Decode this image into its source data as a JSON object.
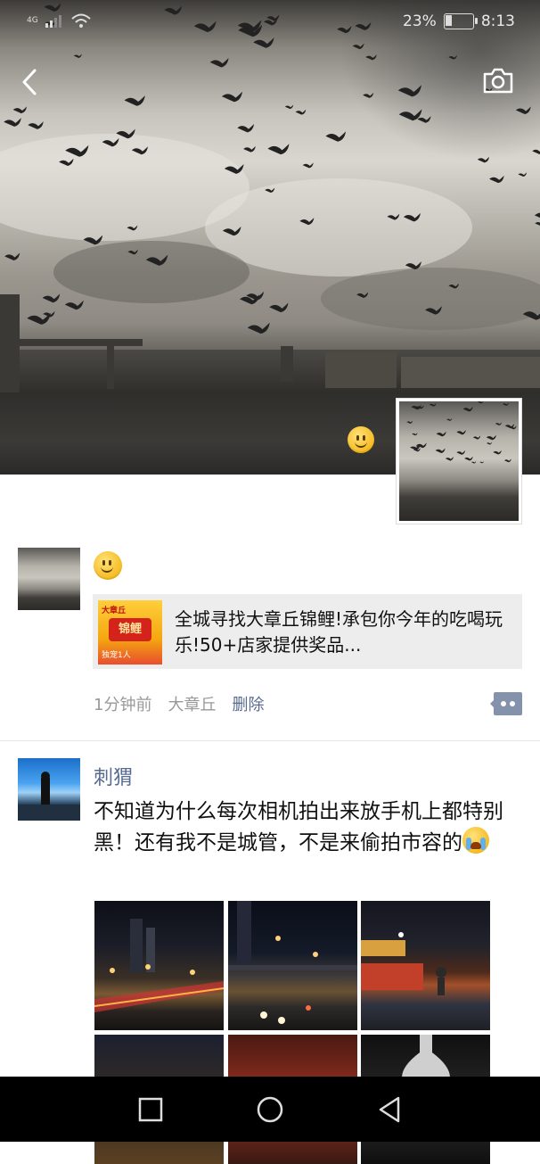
{
  "status_bar": {
    "network": "4G",
    "battery_percent_text": "23%",
    "battery_level": 0.23,
    "time": "8:13"
  },
  "header": {
    "back_icon": "chevron-left-icon",
    "camera_icon": "camera-icon"
  },
  "cover": {
    "emoji": "slightly-smiling-face"
  },
  "posts": [
    {
      "emoji": "slightly-smiling-face",
      "shared_link": {
        "thumb_text_top": "大章丘",
        "thumb_text_main": "锦鲤",
        "thumb_text_bottom": "独宠1人",
        "title": "全城寻找大章丘锦鲤!承包你今年的吃喝玩乐!50+店家提供奖品..."
      },
      "time": "1分钟前",
      "location": "大章丘",
      "delete_label": "删除"
    },
    {
      "author": "刺猬",
      "text": "不知道为什么每次相机拍出来放手机上都特别黑！还有我不是城管，不是来偷拍市容的",
      "text_emoji": "loudly-crying-face",
      "photos": 6
    }
  ],
  "android_nav": {
    "recent_icon": "square-icon",
    "home_icon": "circle-icon",
    "back_icon": "triangle-back-icon"
  }
}
